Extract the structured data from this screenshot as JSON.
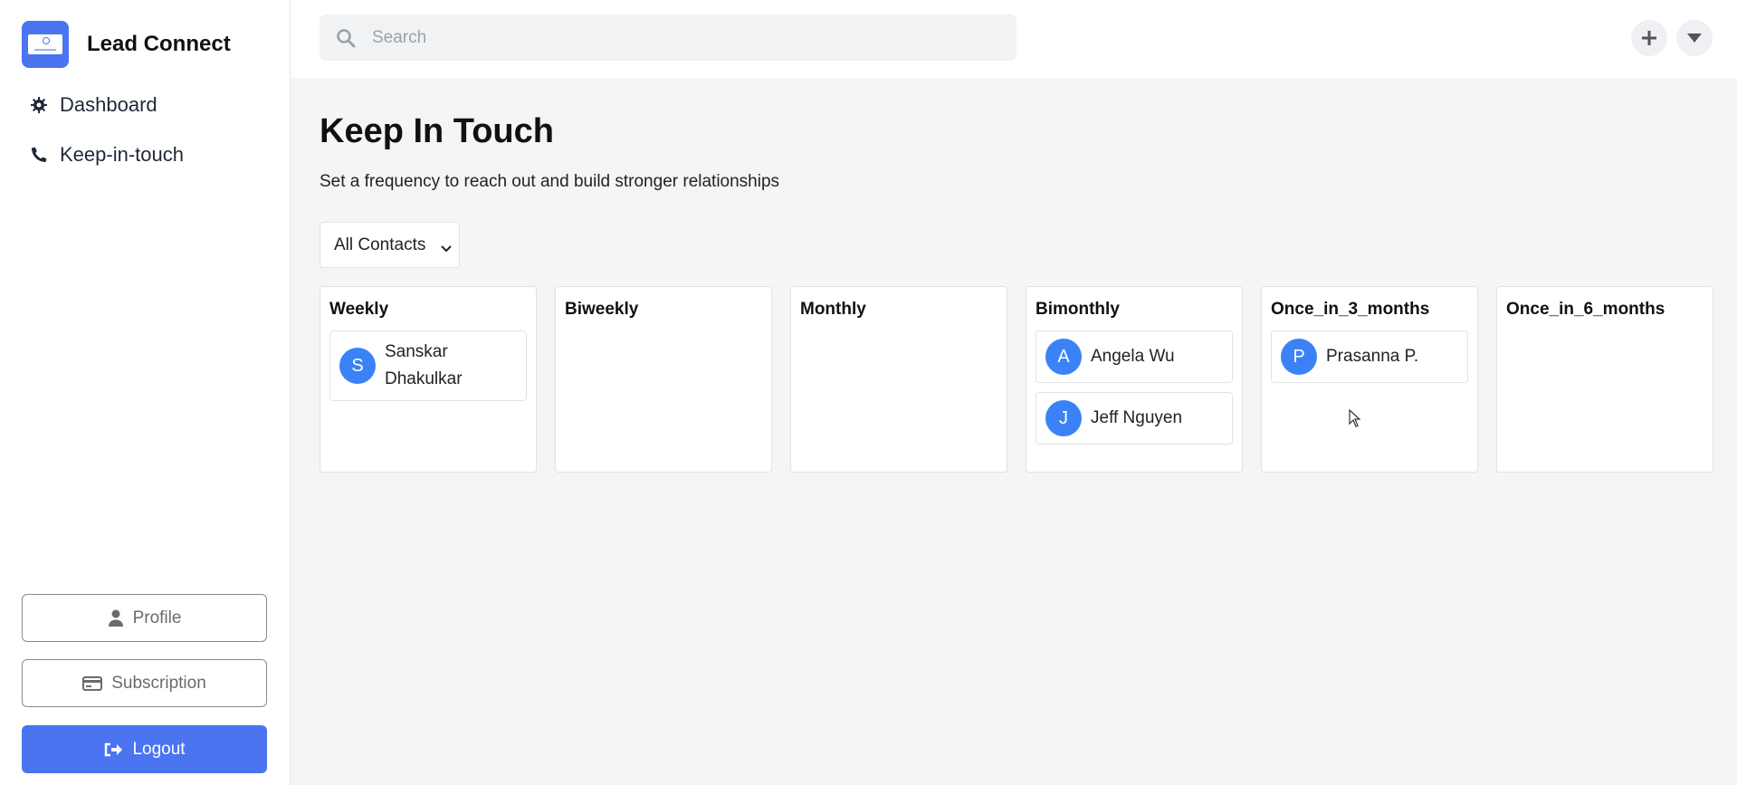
{
  "app": {
    "name": "Lead Connect"
  },
  "sidebar": {
    "nav": [
      {
        "label": "Dashboard",
        "icon": "gear-icon"
      },
      {
        "label": "Keep-in-touch",
        "icon": "phone-icon"
      }
    ],
    "profile_label": "Profile",
    "subscription_label": "Subscription",
    "logout_label": "Logout"
  },
  "search": {
    "placeholder": "Search"
  },
  "page": {
    "title": "Keep In Touch",
    "subtitle": "Set a frequency to reach out and build stronger relationships"
  },
  "filter": {
    "selected": "All Contacts"
  },
  "columns": [
    {
      "title": "Weekly",
      "contacts": [
        {
          "initial": "S",
          "name": "Sanskar Dhakulkar"
        }
      ]
    },
    {
      "title": "Biweekly",
      "contacts": []
    },
    {
      "title": "Monthly",
      "contacts": []
    },
    {
      "title": "Bimonthly",
      "contacts": [
        {
          "initial": "A",
          "name": "Angela Wu"
        },
        {
          "initial": "J",
          "name": "Jeff Nguyen"
        }
      ]
    },
    {
      "title": "Once_in_3_months",
      "contacts": [
        {
          "initial": "P",
          "name": "Prasanna P."
        }
      ]
    },
    {
      "title": "Once_in_6_months",
      "contacts": []
    }
  ],
  "colors": {
    "accent": "#4a74f0",
    "avatar": "#3b82f6"
  }
}
